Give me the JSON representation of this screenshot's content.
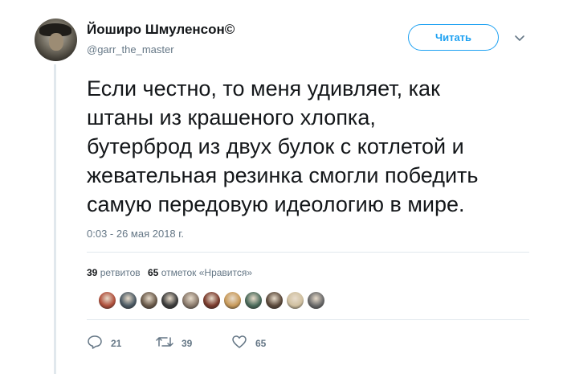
{
  "tweet": {
    "user": {
      "name": "Йоширо Шмуленсон©",
      "handle": "@garr_the_master"
    },
    "follow_label": "Читать",
    "text": "Если честно, то меня удивляет, как\nштаны из крашеного хлопка,\nбутерброд из двух булок с котлетой и\nжевательная резинка смогли победить\nсамую передовую идеологию в мире.",
    "timestamp": "0:03 - 26 мая 2018 г.",
    "stats": {
      "retweets_count": "39",
      "retweets_label": "ретвитов",
      "likes_count": "65",
      "likes_label": "отметок «Нравится»"
    },
    "liker_avatar_colors": [
      "#b0503c",
      "#4c5a64",
      "#6a5a4a",
      "#3c3c3c",
      "#8a7a6c",
      "#7a3a2c",
      "#c89a5a",
      "#4a6a5a",
      "#5c4a3c",
      "#d0c0a0",
      "#6a6a6a"
    ],
    "actions": {
      "reply_count": "21",
      "retweet_count": "39",
      "like_count": "65"
    },
    "colors": {
      "accent": "#1da1f2",
      "muted_text": "#657786",
      "divider": "#e1e8ed"
    },
    "icons": [
      "chevron-down-icon",
      "reply-icon",
      "retweet-icon",
      "heart-icon"
    ]
  }
}
